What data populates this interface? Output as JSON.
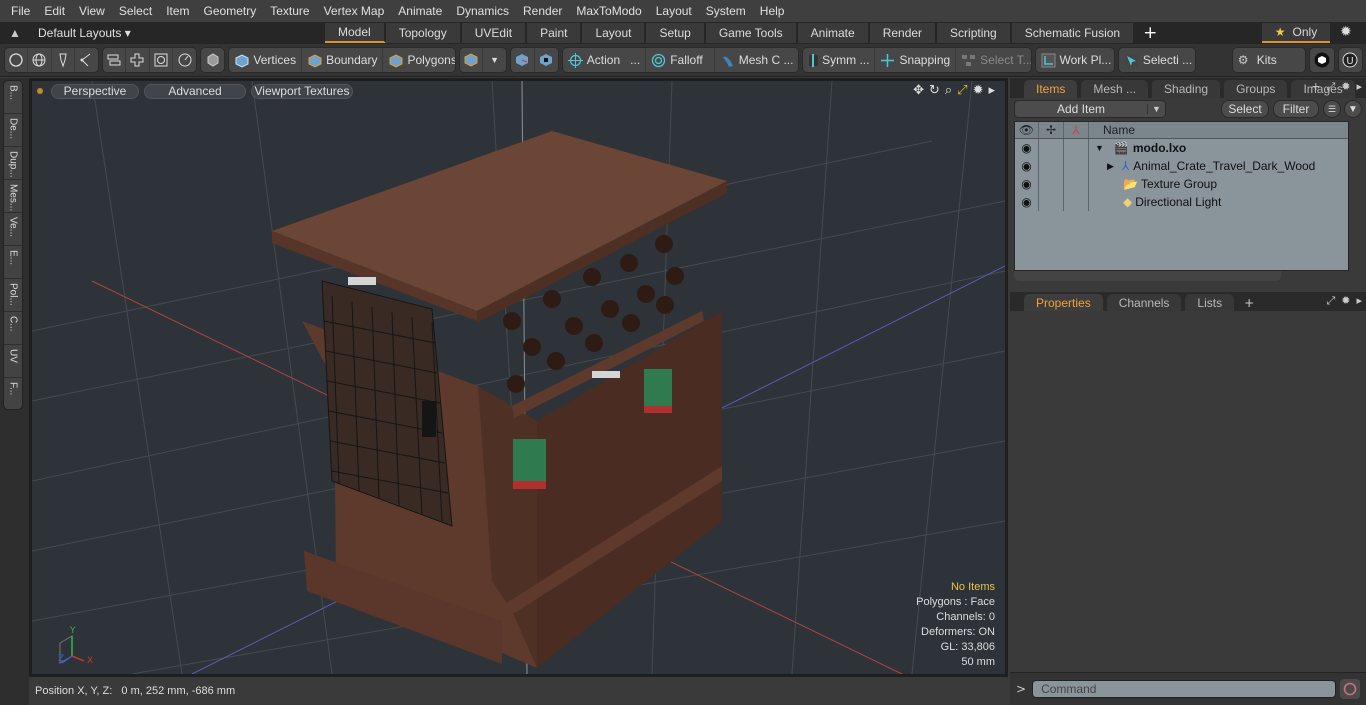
{
  "menu": [
    "File",
    "Edit",
    "View",
    "Select",
    "Item",
    "Geometry",
    "Texture",
    "Vertex Map",
    "Animate",
    "Dynamics",
    "Render",
    "MaxToModo",
    "Layout",
    "System",
    "Help"
  ],
  "layout_selector": "Default Layouts ▾",
  "tabs": [
    {
      "label": "Model",
      "active": true
    },
    {
      "label": "Topology"
    },
    {
      "label": "UVEdit"
    },
    {
      "label": "Paint"
    },
    {
      "label": "Layout"
    },
    {
      "label": "Setup"
    },
    {
      "label": "Game Tools"
    },
    {
      "label": "Animate"
    },
    {
      "label": "Render"
    },
    {
      "label": "Scripting"
    },
    {
      "label": "Schematic Fusion"
    }
  ],
  "only_label": "Only",
  "toolbar": {
    "vertices": "Vertices",
    "boundary": "Boundary",
    "polygons": "Polygons",
    "action": "Action",
    "action_more": "...",
    "falloff": "Falloff",
    "mesh": "Mesh C ...",
    "symm": "Symm ...",
    "snapping": "Snapping",
    "select_t": "Select T...",
    "work_pl": "Work Pl...",
    "selecti": "Selecti ...",
    "kits": "Kits"
  },
  "left_tabs": [
    "B...",
    "De...",
    "Dup...",
    "Mes...",
    "Ve...",
    "E...",
    "Pol...",
    "C...",
    "UV",
    "F..."
  ],
  "viewport": {
    "pills": [
      "Perspective",
      "Advanced",
      "Viewport Textures"
    ],
    "info": {
      "selection": "No Items",
      "polygons": "Polygons : Face",
      "channels": "Channels: 0",
      "deformers": "Deformers: ON",
      "gl": "GL: 33,806",
      "scale": "50 mm"
    },
    "axis": {
      "x": "X",
      "y": "Y",
      "z": "Z"
    }
  },
  "status": {
    "position_label": "Position X, Y, Z:",
    "position_value": "0 m, 252 mm, -686 mm"
  },
  "items_panel": {
    "tabs": [
      {
        "label": "Items",
        "active": true
      },
      {
        "label": "Mesh ..."
      },
      {
        "label": "Shading"
      },
      {
        "label": "Groups"
      },
      {
        "label": "Images"
      }
    ],
    "add_item": "Add Item",
    "select": "Select",
    "filter": "Filter",
    "name_header": "Name",
    "rows": [
      {
        "name": "modo.lxo",
        "bold": true,
        "icon": "scene-icon"
      },
      {
        "name": "Animal_Crate_Travel_Dark_Wood",
        "icon": "mesh-icon"
      },
      {
        "name": "Texture Group",
        "icon": "texture-group-icon"
      },
      {
        "name": "Directional Light",
        "icon": "light-icon"
      }
    ]
  },
  "properties_panel": {
    "tabs": [
      {
        "label": "Properties",
        "active": true
      },
      {
        "label": "Channels"
      },
      {
        "label": "Lists"
      }
    ]
  },
  "command": {
    "placeholder": "Command"
  }
}
